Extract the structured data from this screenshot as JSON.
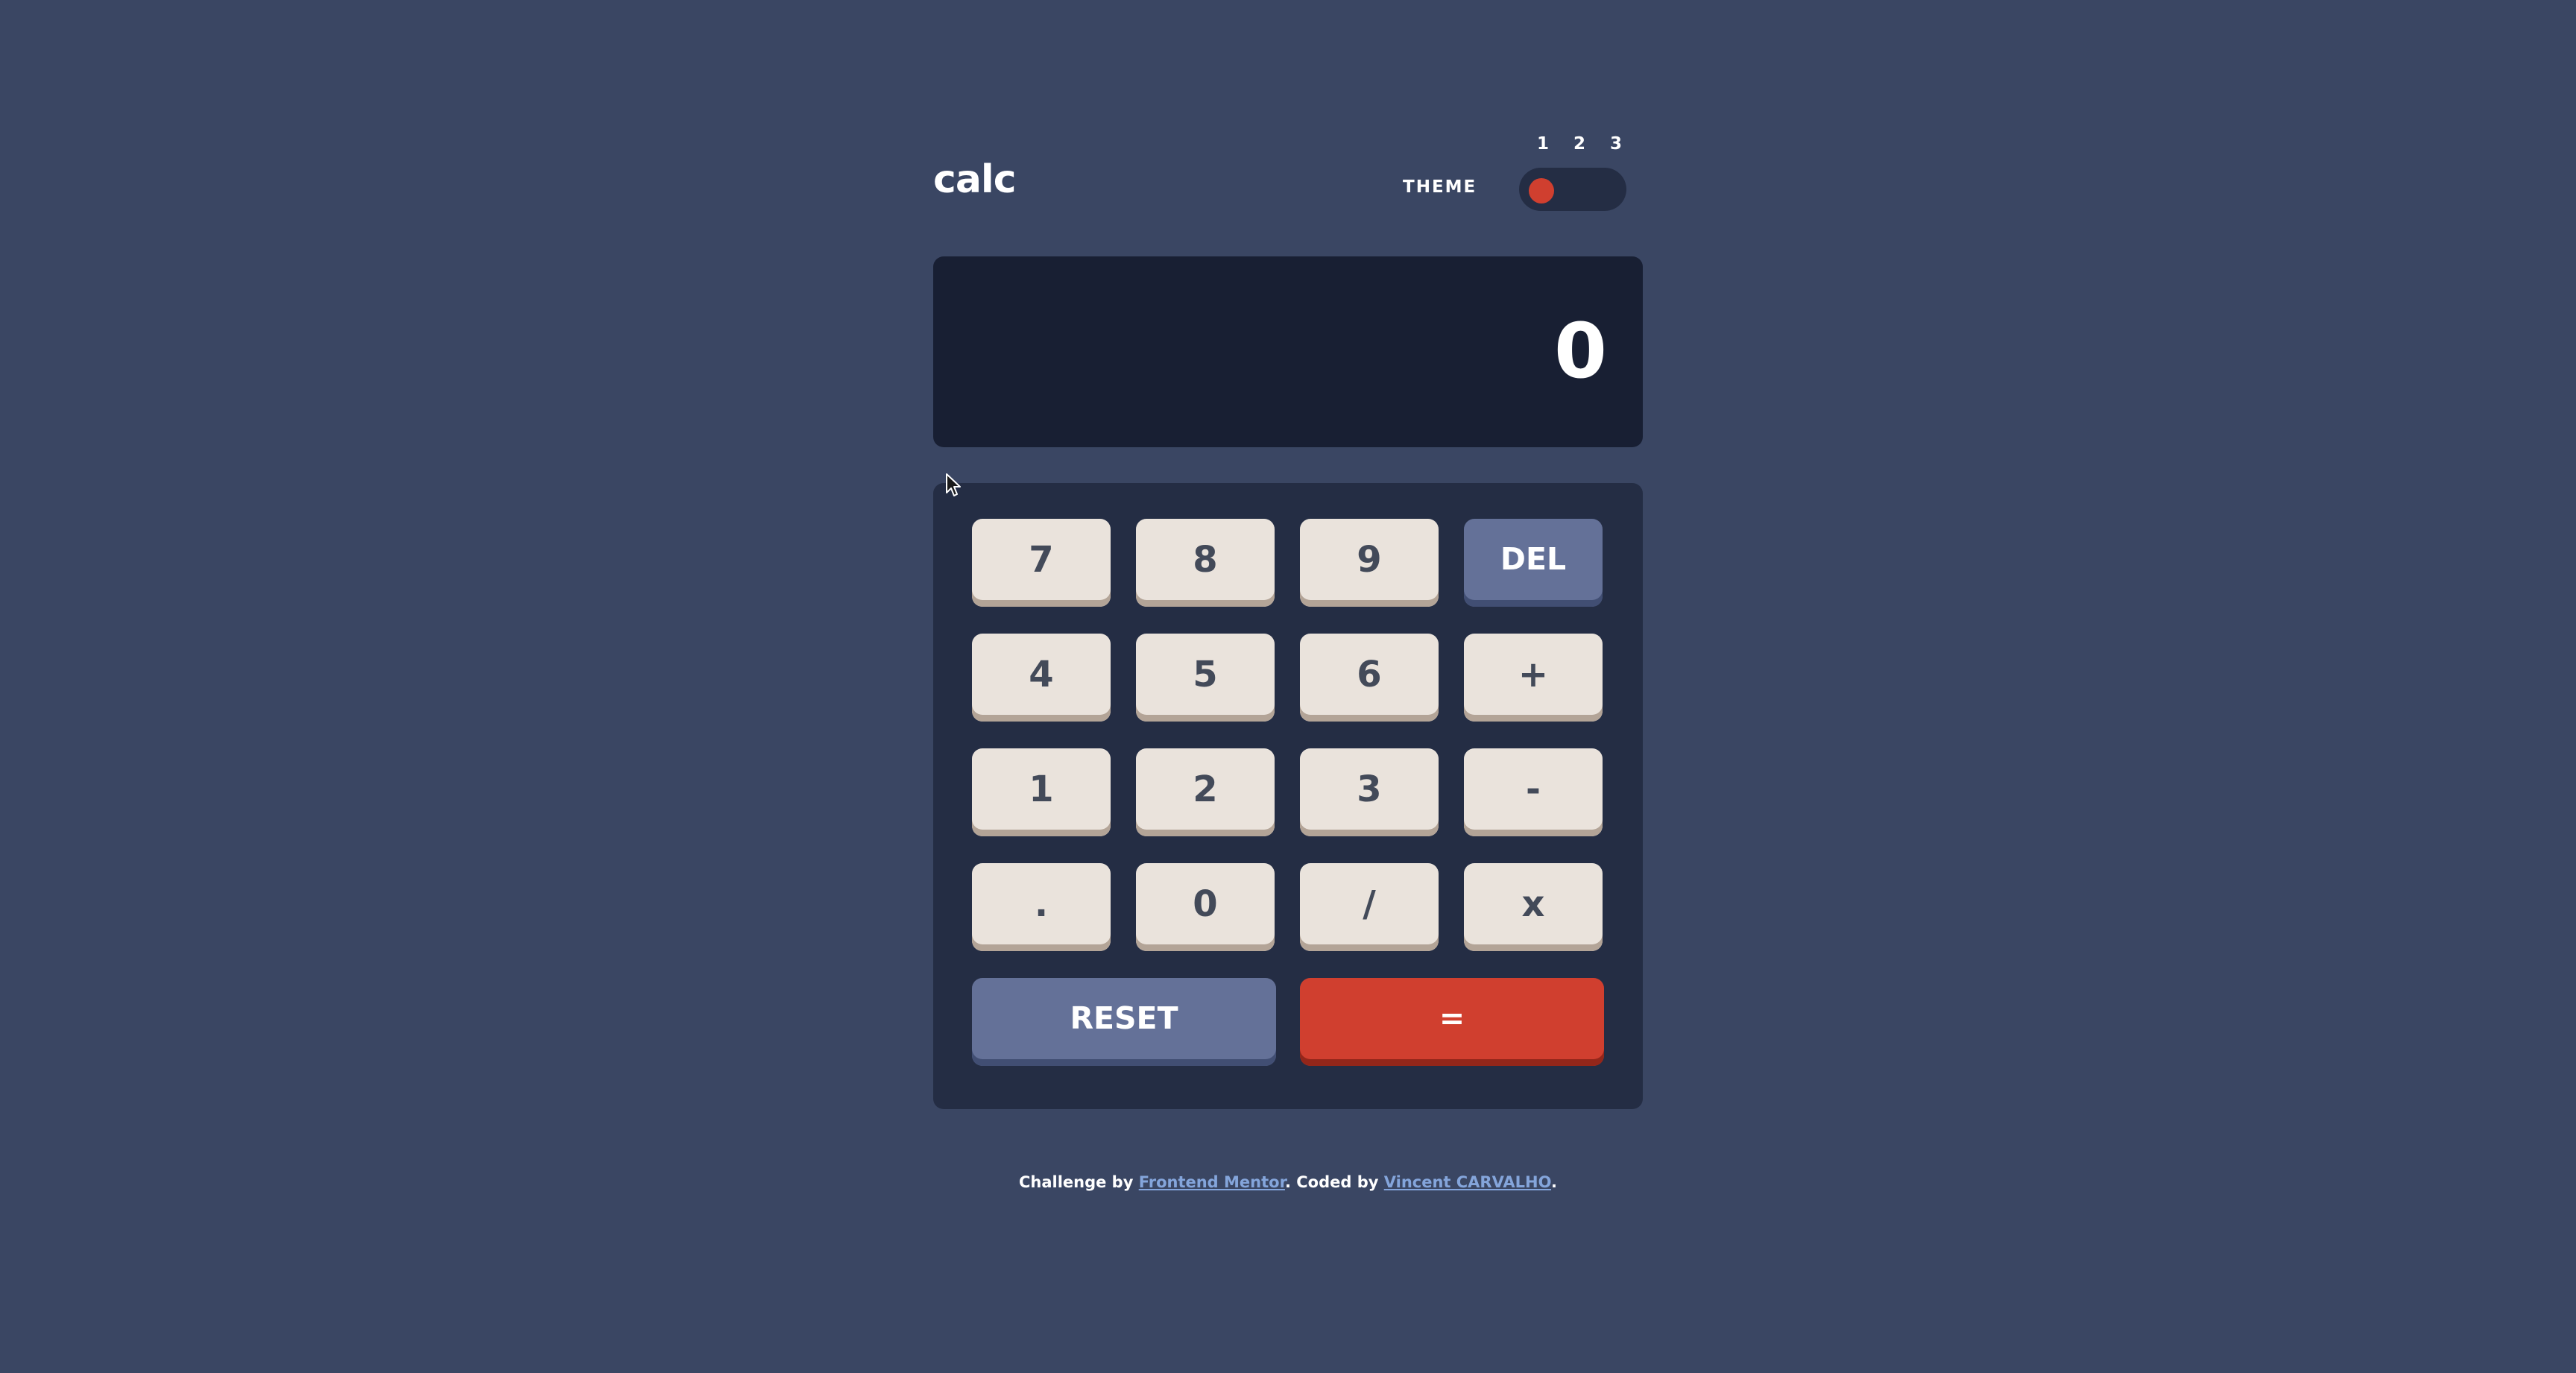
{
  "header": {
    "logo": "calc",
    "theme_label": "THEME",
    "theme_numbers": [
      "1",
      "2",
      "3"
    ],
    "active_theme": 1
  },
  "display": {
    "value": "0"
  },
  "keypad": {
    "row1": [
      "7",
      "8",
      "9",
      "DEL"
    ],
    "row2": [
      "4",
      "5",
      "6",
      "+"
    ],
    "row3": [
      "1",
      "2",
      "3",
      "-"
    ],
    "row4": [
      ".",
      "0",
      "/",
      "x"
    ],
    "reset": "RESET",
    "equals": "="
  },
  "footer": {
    "prefix": "Challenge by ",
    "link1": "Frontend Mentor",
    "middle": ". Coded by ",
    "link2": "Vincent CARVALHO",
    "suffix": "."
  },
  "colors": {
    "background": "#3a4663",
    "panel": "#242d44",
    "display": "#181f33",
    "key": "#eae3dc",
    "key_shadow": "#b3a497",
    "key_text": "#434a59",
    "key_dark": "#647198",
    "key_dark_shadow": "#414e73",
    "accent": "#d03f2f",
    "accent_shadow": "#93261a",
    "link": "#84a5db"
  },
  "icons": {
    "cursor": "mouse-pointer-icon"
  }
}
